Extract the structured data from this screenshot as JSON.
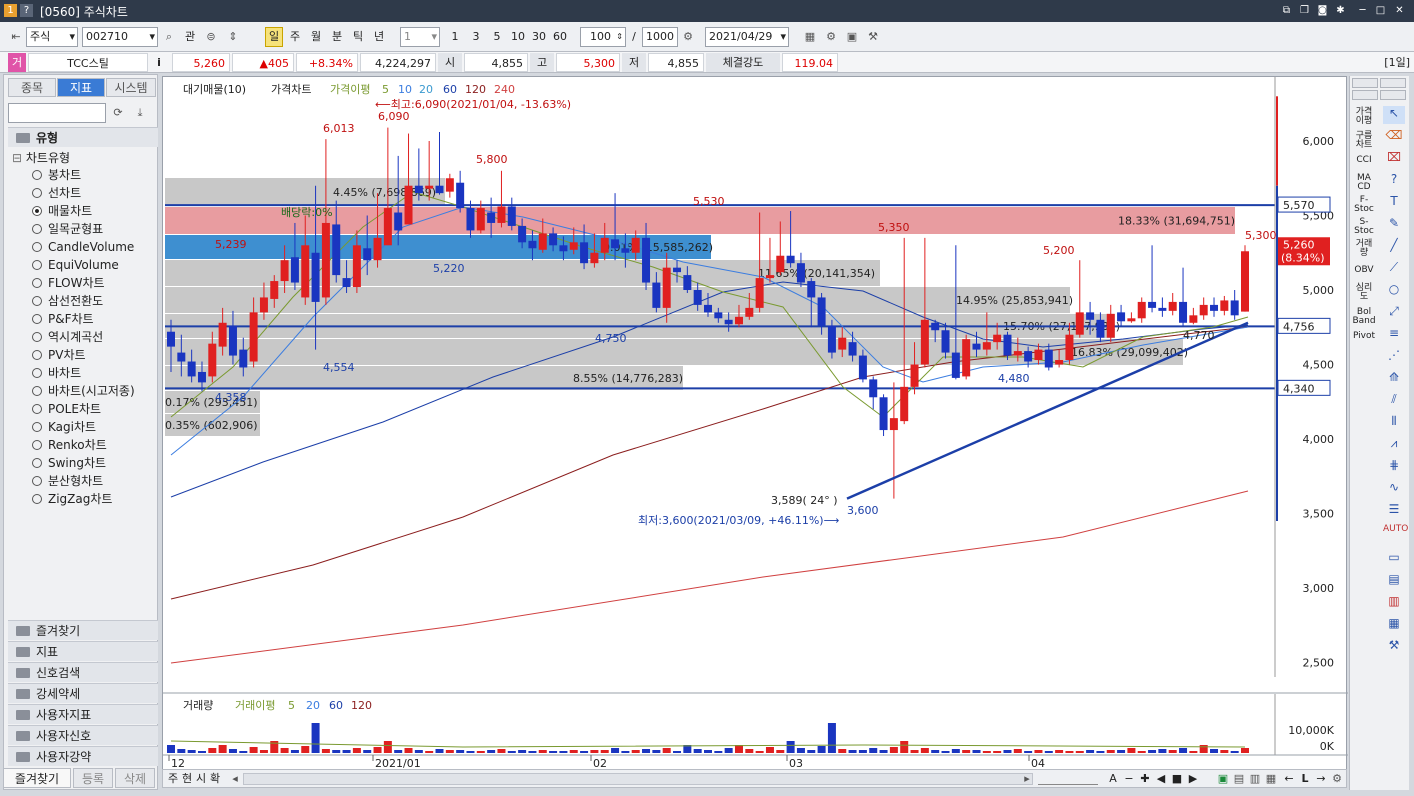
{
  "window": {
    "badge1": "1",
    "badge2": "?",
    "title": "[0560] 주식차트"
  },
  "toolbar": {
    "market": "주식",
    "code": "002710",
    "kwan": "관",
    "periods": [
      "일",
      "주",
      "월",
      "분",
      "틱",
      "년"
    ],
    "unit": "1",
    "minutes": [
      "1",
      "3",
      "5",
      "10",
      "30",
      "60"
    ],
    "count": "100",
    "slash": "/",
    "total": "1000",
    "date": "2021/04/29"
  },
  "quote": {
    "badge": "거",
    "name": "TCC스틸",
    "info": "i",
    "price": "5,260",
    "change": "▲405",
    "pct": "+8.34%",
    "volume": "4,224,297",
    "open_label": "시",
    "open": "4,855",
    "high_label": "고",
    "high": "5,300",
    "low_label": "저",
    "low": "4,855",
    "strength_label": "체결강도",
    "strength": "119.04",
    "period_badge": "[1일]"
  },
  "left": {
    "tabs": [
      "종목",
      "지표",
      "시스템"
    ],
    "group": "유형",
    "tree_root": "차트유형",
    "chart_types": [
      "봉차트",
      "선차트",
      "매물차트",
      "일목균형표",
      "CandleVolume",
      "EquiVolume",
      "FLOW차트",
      "삼선전환도",
      "P&F차트",
      "역시계곡선",
      "PV차트",
      "바차트",
      "바차트(시고저종)",
      "POLE차트",
      "Kagi차트",
      "Renko차트",
      "Swing차트",
      "분산형차트",
      "ZigZag차트"
    ],
    "selected_index": 2,
    "categories": [
      "즐겨찾기",
      "지표",
      "신호검색",
      "강세약세",
      "사용자지표",
      "사용자신호",
      "사용자강약"
    ],
    "bottom_tabs": [
      "즐겨찾기",
      "등록",
      "삭제"
    ]
  },
  "chart": {
    "legend": {
      "a": "대기매물(10)",
      "b": "가격차트",
      "c": "가격이평",
      "n5": "5",
      "n10": "10",
      "n20": "20",
      "n60": "60",
      "n120": "120",
      "n240": "240"
    },
    "vol_legend": {
      "a": "거래량",
      "b": "거래이평",
      "n5": "5",
      "n20": "20",
      "n60": "60",
      "n120": "120"
    },
    "yticks": [
      "6,000",
      "5,500",
      "5,000",
      "4,500",
      "4,000",
      "3,500",
      "3,000",
      "2,500"
    ],
    "ytags": {
      "upper": "5,570",
      "cur": "5,260",
      "curpct": "(8.34%)",
      "mid": "4,756",
      "lower": "4,340"
    },
    "vol_ticks": [
      "10,000K",
      "0K"
    ],
    "xticks": [
      "12",
      "2021/01",
      "02",
      "03",
      "04"
    ],
    "ann": {
      "hi": "⟵최고:6,090(2021/01/04, -13.63%)",
      "lo": "최저:3,600(2021/03/09, +46.11%)⟶",
      "div": "배당락:0%",
      "angle": "3,589( 24° )",
      "p6013": "6,013",
      "p6090": "6,090",
      "p5800": "5,800",
      "p5530": "5,530",
      "p5350": "5,350",
      "p5239": "5,239",
      "p5220": "5,220",
      "p5200": "5,200",
      "p5300": "5,300",
      "p4750": "4,750",
      "p4554": "4,554",
      "p4480": "4,480",
      "p4770": "4,770",
      "p3600": "3,600",
      "p4358": "4,358"
    },
    "profile": [
      {
        "pct": "4.45% (7,698,869)"
      },
      {
        "pct": "18.33% (31,694,751)"
      },
      {
        "pct": "9.01% (15,585,262)"
      },
      {
        "pct": "11.65% (20,141,354)"
      },
      {
        "pct": "14.95% (25,853,941)"
      },
      {
        "pct": "15.70% (27,137,932)"
      },
      {
        "pct": "16.83% (29,099,402)"
      },
      {
        "pct": "8.55% (14,776,283)"
      },
      {
        "pct": "0.17% (293,451)"
      },
      {
        "pct": "0.35% (602,906)"
      }
    ]
  },
  "chart_data": {
    "type": "candlestick",
    "x": [
      "12",
      "2021/01",
      "02",
      "03",
      "04"
    ],
    "ylim": [
      2300,
      6300
    ],
    "levels": [
      5570,
      4756,
      4340
    ],
    "high": 6090,
    "low": 3600,
    "last": 5260,
    "candles": [
      [
        4720,
        4620,
        4800,
        4450
      ],
      [
        4580,
        4520,
        4700,
        4420
      ],
      [
        4520,
        4420,
        4600,
        4380
      ],
      [
        4450,
        4380,
        4520,
        4320
      ],
      [
        4420,
        4640,
        4720,
        4380
      ],
      [
        4620,
        4780,
        4880,
        4560
      ],
      [
        4760,
        4560,
        4860,
        4500
      ],
      [
        4600,
        4480,
        4680,
        4420
      ],
      [
        4520,
        4850,
        4950,
        4480
      ],
      [
        4850,
        4950,
        5050,
        4800
      ],
      [
        4940,
        5060,
        5100,
        4880
      ],
      [
        5060,
        5200,
        5300,
        4980
      ],
      [
        5220,
        5050,
        5450,
        5000
      ],
      [
        4950,
        5300,
        5500,
        4900
      ],
      [
        5250,
        4920,
        5700,
        4600
      ],
      [
        4950,
        5450,
        6013,
        4900
      ],
      [
        5440,
        5100,
        5600,
        5050
      ],
      [
        5080,
        5020,
        5200,
        4980
      ],
      [
        5020,
        5300,
        5400,
        4980
      ],
      [
        5280,
        5200,
        5500,
        5100
      ],
      [
        5200,
        5350,
        5650,
        5150
      ],
      [
        5300,
        5550,
        6090,
        5350
      ],
      [
        5520,
        5400,
        5900,
        5300
      ],
      [
        5440,
        5700,
        6050,
        5650
      ],
      [
        5700,
        5650,
        5950,
        5600
      ],
      [
        5680,
        5700,
        6000,
        5600
      ],
      [
        5700,
        5650,
        6060,
        5640
      ],
      [
        5660,
        5750,
        5780,
        5620
      ],
      [
        5720,
        5550,
        5800,
        5520
      ],
      [
        5550,
        5400,
        5600,
        5350
      ],
      [
        5400,
        5550,
        5600,
        5380
      ],
      [
        5520,
        5450,
        5620,
        5350
      ],
      [
        5450,
        5560,
        5800,
        5420
      ],
      [
        5560,
        5430,
        5620,
        5400
      ],
      [
        5430,
        5320,
        5480,
        5280
      ],
      [
        5330,
        5280,
        5400,
        5200
      ],
      [
        5270,
        5380,
        5480,
        5250
      ],
      [
        5380,
        5300,
        5420,
        5260
      ],
      [
        5300,
        5260,
        5360,
        5200
      ],
      [
        5270,
        5320,
        5420,
        5240
      ],
      [
        5320,
        5180,
        5440,
        5140
      ],
      [
        5180,
        5250,
        5380,
        5150
      ],
      [
        5250,
        5350,
        5450,
        5200
      ],
      [
        5340,
        5280,
        5650,
        5200
      ],
      [
        5280,
        5250,
        5380,
        5150
      ],
      [
        5250,
        5350,
        5400,
        5200
      ],
      [
        5350,
        5050,
        5450,
        5000
      ],
      [
        5050,
        4880,
        5120,
        4850
      ],
      [
        4880,
        5150,
        5250,
        4780
      ],
      [
        5150,
        5120,
        5200,
        5050
      ],
      [
        5100,
        5000,
        5160,
        4980
      ],
      [
        5000,
        4900,
        5050,
        4860
      ],
      [
        4900,
        4850,
        4980,
        4820
      ],
      [
        4850,
        4810,
        4880,
        4780
      ],
      [
        4800,
        4770,
        4850,
        4720
      ],
      [
        4770,
        4820,
        4900,
        4750
      ],
      [
        4820,
        4880,
        4980,
        4800
      ],
      [
        4880,
        5080,
        5520,
        4850
      ],
      [
        5080,
        5100,
        5350,
        5050
      ],
      [
        5120,
        5230,
        5460,
        5100
      ],
      [
        5230,
        5180,
        5530,
        5150
      ],
      [
        5180,
        5050,
        5250,
        5020
      ],
      [
        5060,
        4950,
        5080,
        4750
      ],
      [
        4950,
        4760,
        4980,
        4700
      ],
      [
        4760,
        4580,
        4800,
        4540
      ],
      [
        4600,
        4680,
        4750,
        4550
      ],
      [
        4650,
        4560,
        4720,
        4520
      ],
      [
        4560,
        4400,
        4600,
        4380
      ],
      [
        4400,
        4280,
        4420,
        4200
      ],
      [
        4280,
        4060,
        4300,
        4020
      ],
      [
        4060,
        4140,
        4380,
        3600
      ],
      [
        4120,
        4350,
        5350,
        4100
      ],
      [
        4350,
        4500,
        4650,
        4300
      ],
      [
        4500,
        4800,
        5350,
        4480
      ],
      [
        4780,
        4730,
        4800,
        4650
      ],
      [
        4730,
        4580,
        4780,
        4540
      ],
      [
        4580,
        4410,
        5300,
        4400
      ],
      [
        4420,
        4670,
        4700,
        4400
      ],
      [
        4640,
        4600,
        4720,
        4550
      ],
      [
        4600,
        4650,
        4850,
        4560
      ],
      [
        4650,
        4700,
        4780,
        4600
      ],
      [
        4700,
        4560,
        4720,
        4530
      ],
      [
        4560,
        4590,
        4680,
        4520
      ],
      [
        4590,
        4520,
        4620,
        4480
      ],
      [
        4530,
        4600,
        4640,
        4500
      ],
      [
        4600,
        4480,
        4640,
        4460
      ],
      [
        4500,
        4530,
        4600,
        4480
      ],
      [
        4530,
        4700,
        4780,
        4500
      ],
      [
        4700,
        4850,
        5200,
        4680
      ],
      [
        4850,
        4800,
        4920,
        4700
      ],
      [
        4800,
        4680,
        4850,
        4650
      ],
      [
        4680,
        4840,
        4900,
        4650
      ],
      [
        4850,
        4790,
        4900,
        4760
      ],
      [
        4790,
        4810,
        4850,
        4780
      ],
      [
        4810,
        4920,
        4950,
        4780
      ],
      [
        4920,
        4880,
        5300,
        4850
      ],
      [
        4880,
        4860,
        4950,
        4820
      ],
      [
        4860,
        4920,
        4980,
        4830
      ],
      [
        4920,
        4780,
        5150,
        4760
      ],
      [
        4780,
        4830,
        4880,
        4770
      ],
      [
        4830,
        4900,
        4950,
        4800
      ],
      [
        4900,
        4860,
        4950,
        4820
      ],
      [
        4860,
        4930,
        4960,
        4830
      ],
      [
        4930,
        4830,
        5000,
        4800
      ],
      [
        4855,
        5260,
        5300,
        4855
      ]
    ]
  }
}
